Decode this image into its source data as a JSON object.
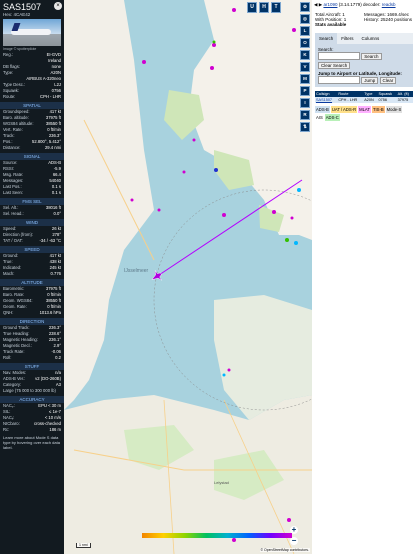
{
  "infobox": {
    "callsign": "SAS1507",
    "hex_line": "Hex: 4CAE42",
    "photo_credit": "Image © spotterpilote",
    "fields_top": [
      {
        "k": "Reg.:",
        "v": "EI-GVD"
      },
      {
        "k": "",
        "v": "Ireland"
      },
      {
        "k": "DB flags:",
        "v": "none"
      },
      {
        "k": "Type:",
        "v": "A20N"
      },
      {
        "k": "",
        "v": "AIRBUS A-320neo"
      },
      {
        "k": "Type Desc.:",
        "v": "L2J"
      },
      {
        "k": "Squawk:",
        "v": "0756"
      },
      {
        "k": "Route:",
        "v": "CPH - LHR"
      }
    ],
    "spatial_title": "SPATIAL",
    "spatial": [
      {
        "k": "Groundspeed:",
        "v": "417 kt"
      },
      {
        "k": "Baro. altitude:",
        "v": "37975 ft"
      },
      {
        "k": "WGS84 altitude:",
        "v": "38550 ft"
      },
      {
        "k": "Vert. Rate:",
        "v": "0 ft/min"
      },
      {
        "k": "Track:",
        "v": "236.3°"
      },
      {
        "k": "Pos.:",
        "v": "52.800°, 5.412°"
      },
      {
        "k": "Distance:",
        "v": "29.4 nmi"
      }
    ],
    "signal_title": "SIGNAL",
    "signal": [
      {
        "k": "Source:",
        "v": "ADS-B"
      },
      {
        "k": "RSSI:",
        "v": "-5.9"
      },
      {
        "k": "Msg. Rate:",
        "v": "66.4"
      },
      {
        "k": "Messages:",
        "v": "54040"
      },
      {
        "k": "Last Pos.:",
        "v": "0.1 s"
      },
      {
        "k": "Last Seen:",
        "v": "0.1 s"
      }
    ],
    "fms_title": "FMS SEL",
    "fms": [
      {
        "k": "Sel. Alt.:",
        "v": "38016 ft"
      },
      {
        "k": "Sel. Head.:",
        "v": "0.0°"
      }
    ],
    "wind_title": "WIND",
    "wind": [
      {
        "k": "Speed:",
        "v": "26 kt"
      },
      {
        "k": "Direction (from):",
        "v": "278°"
      },
      {
        "k": "TAT / OAT:",
        "v": "-34 / -63 °C"
      }
    ],
    "speed_title": "SPEED",
    "speed": [
      {
        "k": "Ground:",
        "v": "417 kt"
      },
      {
        "k": "True:",
        "v": "438 kt"
      },
      {
        "k": "Indicated:",
        "v": "245 kt"
      },
      {
        "k": "Mach:",
        "v": "0.776"
      }
    ],
    "altitude_title": "ALTITUDE",
    "altitude": [
      {
        "k": "Barometric:",
        "v": "37975 ft"
      },
      {
        "k": "Baro. Rate:",
        "v": "0 ft/min"
      },
      {
        "k": "Geom. WGS84:",
        "v": "38550 ft"
      },
      {
        "k": "Geom. Rate:",
        "v": "0 ft/min"
      },
      {
        "k": "QNH:",
        "v": "1013.6 hPa"
      }
    ],
    "direction_title": "DIRECTION",
    "direction": [
      {
        "k": "Ground Track:",
        "v": "236.3°"
      },
      {
        "k": "True Heading:",
        "v": "238.6°"
      },
      {
        "k": "Magnetic Heading:",
        "v": "236.1°"
      },
      {
        "k": "Magnetic Decl.:",
        "v": "2.9°"
      },
      {
        "k": "Track Rate:",
        "v": "-0.06"
      },
      {
        "k": "Roll:",
        "v": "0.2"
      }
    ],
    "stuff_title": "STUFF",
    "stuff": [
      {
        "k": "Nav. Modes:",
        "v": "n/a"
      },
      {
        "k": "ADS-B Ver.:",
        "v": "v2 (DO-260B)"
      },
      {
        "k": "Category:",
        "v": "A3"
      },
      {
        "k": "Large (75 000 to 300 000 lb)",
        "v": ""
      }
    ],
    "accuracy_title": "ACCURACY",
    "accuracy": [
      {
        "k": "NACₚ:",
        "v": "EPU < 30 m"
      },
      {
        "k": "SIL:",
        "v": "≤ 1e-7"
      },
      {
        "k": "NACᵥ:",
        "v": "< 10 m/s"
      },
      {
        "k": "NICbaro:",
        "v": "cross-checked"
      },
      {
        "k": "Rc:",
        "v": "186 m"
      }
    ],
    "footnote": "Learn more about Mode S data type by hovering over each data label."
  },
  "map": {
    "top_buttons": [
      "U",
      "H",
      "T"
    ],
    "side_buttons": [
      "L",
      "O",
      "K",
      "V",
      "M",
      "P",
      "I",
      "R"
    ],
    "zoom_in": "+",
    "zoom_out": "−",
    "city_label": "IJsselmeer",
    "city2": "Lelystad",
    "scale_label": "1 nmi",
    "attribution": "© OpenStreetMap contributors."
  },
  "sidebar": {
    "version_link": "ar1090",
    "version_text": "(3.14.1779) decoder:",
    "decoder_link": "readsb",
    "stats": [
      {
        "k": "Total Aircraft:",
        "v": "1"
      },
      {
        "k": "Messages:",
        "v": "1669.4/sec"
      },
      {
        "k": "With Position:",
        "v": "1"
      },
      {
        "k": "History:",
        "v": "25240 positions"
      }
    ],
    "stats_label": "Stats available",
    "tabs": [
      "Search",
      "Filters",
      "Columns"
    ],
    "search_label": "Search:",
    "search_btn": "Search",
    "clear_btn": "Clear Search",
    "jump_label": "Jump to Airport or Latitude, Longitude:",
    "jump_btn": "Jump",
    "clear2_btn": "Clear",
    "table_headers": [
      "Callsign",
      "Route",
      "Type",
      "Squawk",
      "Alt. (ft)"
    ],
    "table_row": [
      "SAS1507",
      "CPH - LHR",
      "A20N",
      "0756",
      "37975"
    ],
    "legend": [
      {
        "label": "ADS-B",
        "color": "#cfe0f0"
      },
      {
        "label": "UAT / ADS-R",
        "color": "#ffe08a"
      },
      {
        "label": "MLAT",
        "color": "#ffb0ff"
      },
      {
        "label": "TIS-B",
        "color": "#ffc080"
      },
      {
        "label": "Mode-S",
        "color": "#e0e0e0"
      },
      {
        "label": "AIS",
        "color": "#ffffff"
      },
      {
        "label": "ADS-C",
        "color": "#b8f0b8"
      }
    ]
  }
}
